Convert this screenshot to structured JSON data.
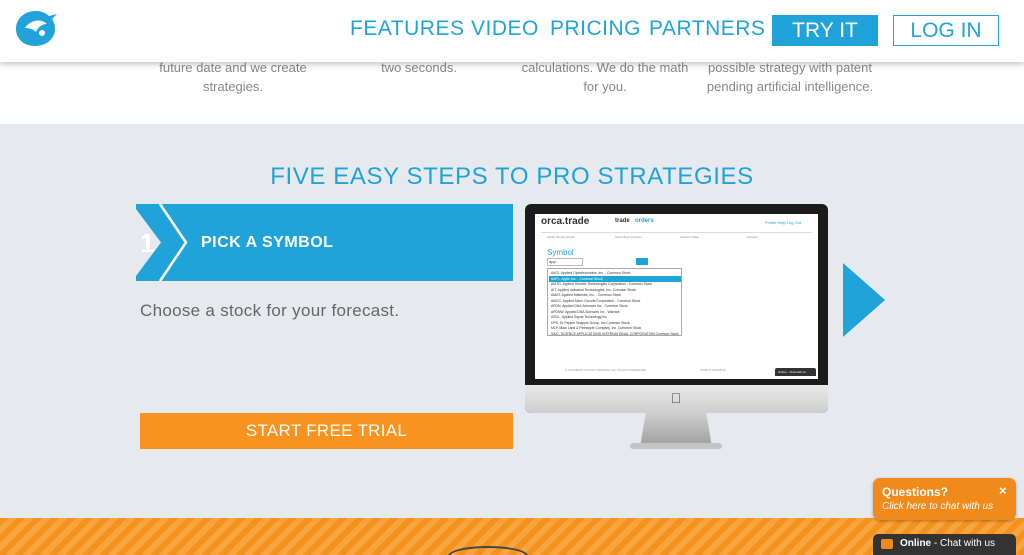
{
  "header": {
    "nav": [
      "FEATURES",
      "VIDEO",
      "PRICING",
      "PARTNERS"
    ],
    "try_label": "TRY IT",
    "login_label": "LOG IN"
  },
  "top_texts": [
    {
      "line1": "future date and we create",
      "line2": "strategies."
    },
    {
      "line1": "two seconds.",
      "line2": ""
    },
    {
      "line1": "calculations. We do the math",
      "line2": "for you."
    },
    {
      "line1": "possible strategy with patent",
      "line2": "pending artificial intelligence."
    }
  ],
  "steps": {
    "title": "FIVE EASY STEPS TO PRO STRATEGIES",
    "number": "1",
    "label": "PICK A SYMBOL",
    "description": "Choose a stock for your forecast.",
    "cta": "START FREE TRIAL"
  },
  "screen": {
    "logo": "orca.trade",
    "tab_trade": "trade",
    "tab_orders": "orders",
    "links": "Profile   Help   Log Out",
    "info": [
      "Option Buying Power",
      "Stock Buying Power",
      "Account Value",
      "Account"
    ],
    "symbol_label": "Symbol",
    "input_value": "app",
    "dropdown": [
      "AAOI, Applied Optoelectronics, Inc. - Common Stock",
      "AAPL, Apple Inc. - Common Stock",
      "AMTG, Applied Genetic Technologies Corporation - Common Stock",
      "AIT, Applied Industrial Technologies, Inc. Common Stock",
      "AMAT, Applied Materials, Inc. - Common Stock",
      "AMCC, Applied Micro Circuits Corporation - Common Stock",
      "APDN, Applied DNA Sciences Inc - Common Stock",
      "APDNW, Applied DNA Sciences Inc - Warrant",
      "ASGL, Applied Signal Technology Inc",
      "DPS, Dr Pepper Snapple Group, Inc Common Stock",
      "MLP, Maui Land & Pineapple Company, Inc. Common Stock",
      "SAIC, SCIENCE APPLICATIONS INTERNATIONAL CORPORATION Common Stock"
    ],
    "footer_left": "© 2014 BEST OPTION TRADING. ALL RIGHTS RESERVED.",
    "footer_mid": "PATENT PENDING",
    "chat": "Online - Chat with us"
  },
  "chat": {
    "question": "Questions?",
    "sub": "Click here to chat with us",
    "close": "×",
    "status_bold": "Online",
    "status_rest": " - Chat with us"
  },
  "colors": {
    "brand_blue": "#1fa3d8",
    "accent_orange": "#f7931e",
    "section_bg": "#e6eaee"
  }
}
